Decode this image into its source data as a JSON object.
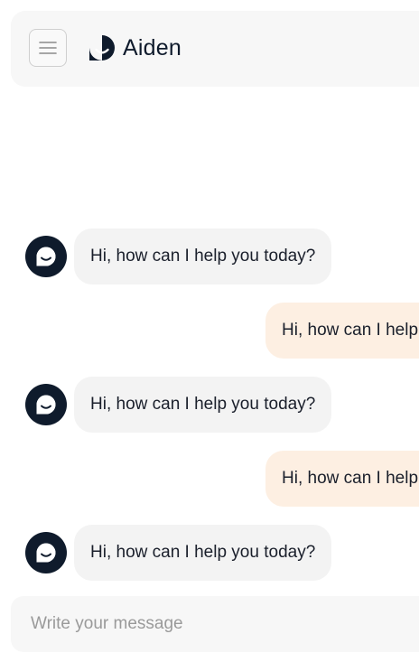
{
  "header": {
    "brand_name": "Aiden"
  },
  "messages": [
    {
      "role": "assistant",
      "text": "Hi, how can I help you today?"
    },
    {
      "role": "user",
      "text": "Hi, how can I help you today?"
    },
    {
      "role": "assistant",
      "text": "Hi, how can I help you today?"
    },
    {
      "role": "user",
      "text": "Hi, how can I help you today?"
    },
    {
      "role": "assistant",
      "text": "Hi, how can I help you today?"
    }
  ],
  "composer": {
    "placeholder": "Write your message",
    "value": ""
  },
  "icons": {
    "menu": "hamburger-menu-icon",
    "logo": "smile-bubble-logo-icon",
    "avatar": "smile-bubble-avatar-icon"
  },
  "colors": {
    "brand_dark": "#0f1b2c",
    "assistant_bubble": "#f3f3f3",
    "user_bubble": "#fdefe2",
    "surface": "#f7f7f7"
  }
}
